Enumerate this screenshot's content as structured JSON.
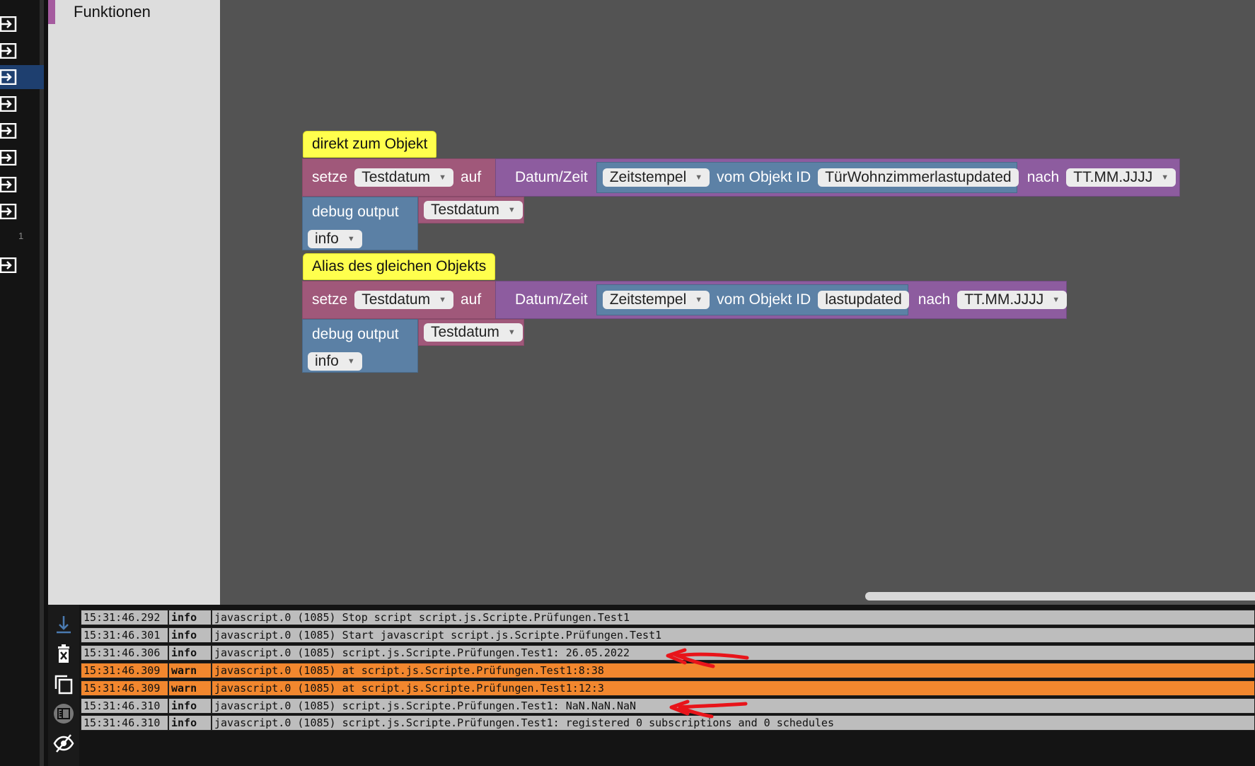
{
  "toolbox": {
    "category": "Funktionen",
    "category_color": "#a55b9f"
  },
  "rail": {
    "badge": "1",
    "active_color": "#1e3f6f"
  },
  "blocks": [
    {
      "comment": "direkt zum Objekt",
      "setze": "setze",
      "var": "Testdatum",
      "auf": "auf",
      "datum": "Datum/Zeit",
      "zeit": "Zeitstempel",
      "vom": "vom Objekt ID",
      "objid": "TürWohnzimmerlastupdated",
      "nach": "nach",
      "format": "TT.MM.JJJJ",
      "debug": "debug output",
      "debug_var": "Testdatum",
      "level": "info"
    },
    {
      "comment": "Alias des gleichen Objekts",
      "setze": "setze",
      "var": "Testdatum",
      "auf": "auf",
      "datum": "Datum/Zeit",
      "zeit": "Zeitstempel",
      "vom": "vom Objekt ID",
      "objid": "lastupdated",
      "nach": "nach",
      "format": "TT.MM.JJJJ",
      "debug": "debug output",
      "debug_var": "Testdatum",
      "level": "info"
    }
  ],
  "logs": [
    {
      "time": "15:31:46.292",
      "level": "info",
      "msg": "javascript.0 (1085) Stop script script.js.Scripte.Prüfungen.Test1"
    },
    {
      "time": "15:31:46.301",
      "level": "info",
      "msg": "javascript.0 (1085) Start javascript script.js.Scripte.Prüfungen.Test1"
    },
    {
      "time": "15:31:46.306",
      "level": "info",
      "msg": "javascript.0 (1085) script.js.Scripte.Prüfungen.Test1: 26.05.2022"
    },
    {
      "time": "15:31:46.309",
      "level": "warn",
      "msg": "javascript.0 (1085) at script.js.Scripte.Prüfungen.Test1:8:38"
    },
    {
      "time": "15:31:46.309",
      "level": "warn",
      "msg": "javascript.0 (1085) at script.js.Scripte.Prüfungen.Test1:12:3"
    },
    {
      "time": "15:31:46.310",
      "level": "info",
      "msg": "javascript.0 (1085) script.js.Scripte.Prüfungen.Test1: NaN.NaN.NaN"
    },
    {
      "time": "15:31:46.310",
      "level": "info",
      "msg": "javascript.0 (1085) script.js.Scripte.Prüfungen.Test1: registered 0 subscriptions and 0 schedules"
    }
  ],
  "colors": {
    "warn": "#f2872e",
    "info": "#bdbdbd",
    "annotation": "#e8141a"
  }
}
